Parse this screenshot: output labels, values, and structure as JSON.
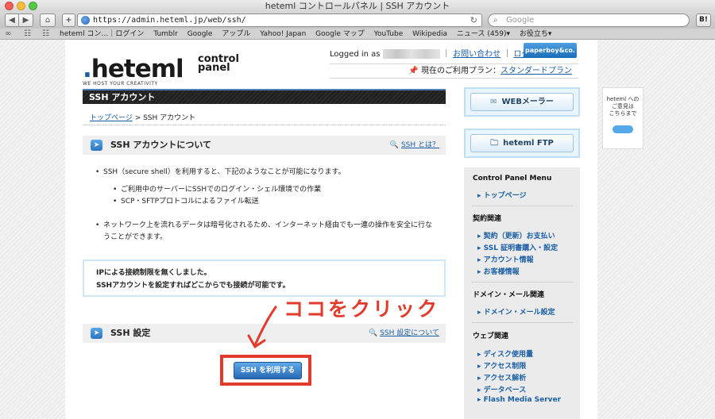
{
  "window": {
    "title": "heteml コントロールパネル | SSH アカウント"
  },
  "toolbar": {
    "back_icon": "◀",
    "forward_icon": "▶",
    "home_icon": "⌂",
    "add_icon": "+",
    "url": "https://admin.heteml.jp/web/ssh/",
    "reload_icon": "↻",
    "search_placeholder": "Google",
    "hatena_label": "B!"
  },
  "bookmarks": {
    "items": [
      "heteml コン…｜ログイン",
      "Tumblr",
      "Google",
      "アップル",
      "Yahoo! Japan",
      "Google マップ",
      "YouTube",
      "Wikipedia",
      "ニュース (459)▾",
      "お役立ち▾"
    ]
  },
  "header": {
    "logo_text": "heteml",
    "logo_tagline": "WE HOST YOUR CREATIVITY",
    "logo_control": "control",
    "logo_panel": "panel",
    "logged_in_label": "Logged in as",
    "contact_link": "お問い合わせ",
    "logout_link": "ログアウト",
    "paperboy_label": "paperboy&co.",
    "plan_label": "現在のご利用プラン：",
    "plan_value": "スタンダードプラン"
  },
  "main": {
    "page_title": "SSH アカウント",
    "breadcrumb_home": "トップページ",
    "breadcrumb_sep": " > ",
    "breadcrumb_current": "SSH アカウント",
    "about": {
      "title": "SSH アカウントについて",
      "link": "SSH とは？",
      "bullet1": "SSH（secure shell）を利用すると、下記のようなことが可能になります。",
      "sub1": "ご利用中のサーバーにSSHでのログイン・シェル環境での作業",
      "sub2": "SCP・SFTPプロトコルによるファイル転送",
      "bullet2_line1": "ネットワーク上を流れるデータは暗号化されるため、インターネット経由でも一連の操作を安全に行な",
      "bullet2_line2": "うことができます。"
    },
    "notice": {
      "line1": "IPによる接続制限を無くしました。",
      "line2": "SSHアカウントを設定すればどこからでも接続が可能です。"
    },
    "ssh_settings": {
      "title": "SSH 設定",
      "link": "SSH 設定について",
      "button_label": "SSH を利用する"
    },
    "annotation": "ココをクリック"
  },
  "sidebar": {
    "webmailer_label": "WEBメーラー",
    "ftp_label": "heteml FTP",
    "menu_title": "Control Panel Menu",
    "top_page": "トップページ",
    "contract_heading": "契約関連",
    "contract_items": [
      "契約（更新）お支払い",
      "SSL 証明書購入・設定",
      "アカウント情報",
      "お客様情報"
    ],
    "domain_heading": "ドメイン・メール関連",
    "domain_items": [
      "ドメイン・メール設定"
    ],
    "web_heading": "ウェブ関連",
    "web_items": [
      "ディスク使用量",
      "アクセス制限",
      "アクセス解析",
      "データベース",
      "Flash Media Server"
    ]
  },
  "feedback": {
    "line1": "heteml への",
    "line2": "ご意見は",
    "line3": "こちらまで"
  },
  "colors": {
    "accent": "#1a5fa6",
    "highlight": "#e23a2b"
  }
}
